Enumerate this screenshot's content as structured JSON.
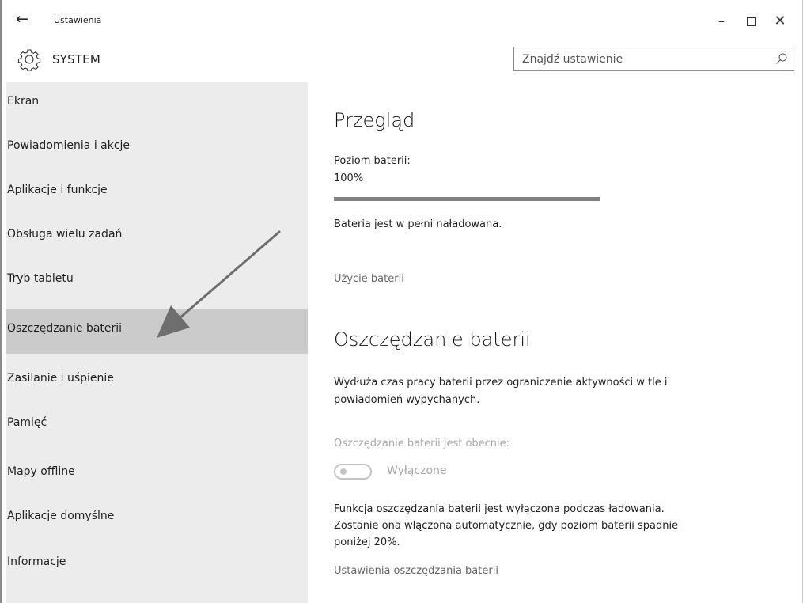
{
  "window": {
    "title": "Ustawienia",
    "back_icon": "←",
    "minimize_icon": "–",
    "close_icon": "✕"
  },
  "header": {
    "section_title": "SYSTEM",
    "search_placeholder": "Znajdź ustawienie"
  },
  "sidebar": {
    "selected_index": 5,
    "items": [
      {
        "label": "Ekran"
      },
      {
        "label": "Powiadomienia i akcje"
      },
      {
        "label": "Aplikacje i funkcje"
      },
      {
        "label": "Obsługa wielu zadań"
      },
      {
        "label": "Tryb tabletu"
      },
      {
        "label": "Oszczędzanie baterii"
      },
      {
        "label": "Zasilanie i uśpienie"
      },
      {
        "label": "Pamięć"
      },
      {
        "label": "Mapy offline"
      },
      {
        "label": "Aplikacje domyślne"
      },
      {
        "label": "Informacje"
      }
    ]
  },
  "overview": {
    "heading": "Przegląd",
    "battery_level_label": "Poziom baterii:",
    "battery_level_value": "100%",
    "battery_fraction": 1.0,
    "status": "Bateria jest w pełni naładowana.",
    "usage_link": "Użycie baterii"
  },
  "battery_saver": {
    "heading": "Oszczędzanie baterii",
    "description_line1": "Wydłuża czas pracy baterii przez ograniczenie aktywności w tle i",
    "description_line2": "powiadomień wypychanych.",
    "current_state_label": "Oszczędzanie baterii jest obecnie:",
    "toggle_state": "Wyłączone",
    "toggle_on": false,
    "note_line1": "Funkcja oszczędzania baterii jest wyłączona podczas ładowania.",
    "note_line2": "Zostanie ona włączona automatycznie, gdy poziom baterii spadnie",
    "note_line3": "poniżej 20%.",
    "settings_link": "Ustawienia oszczędzania baterii"
  },
  "colors": {
    "sidebar_bg": "#ececec",
    "selected_bg": "#cbcbcb",
    "disabled_text": "#a8a8a8",
    "progress_fill": "#808080"
  }
}
